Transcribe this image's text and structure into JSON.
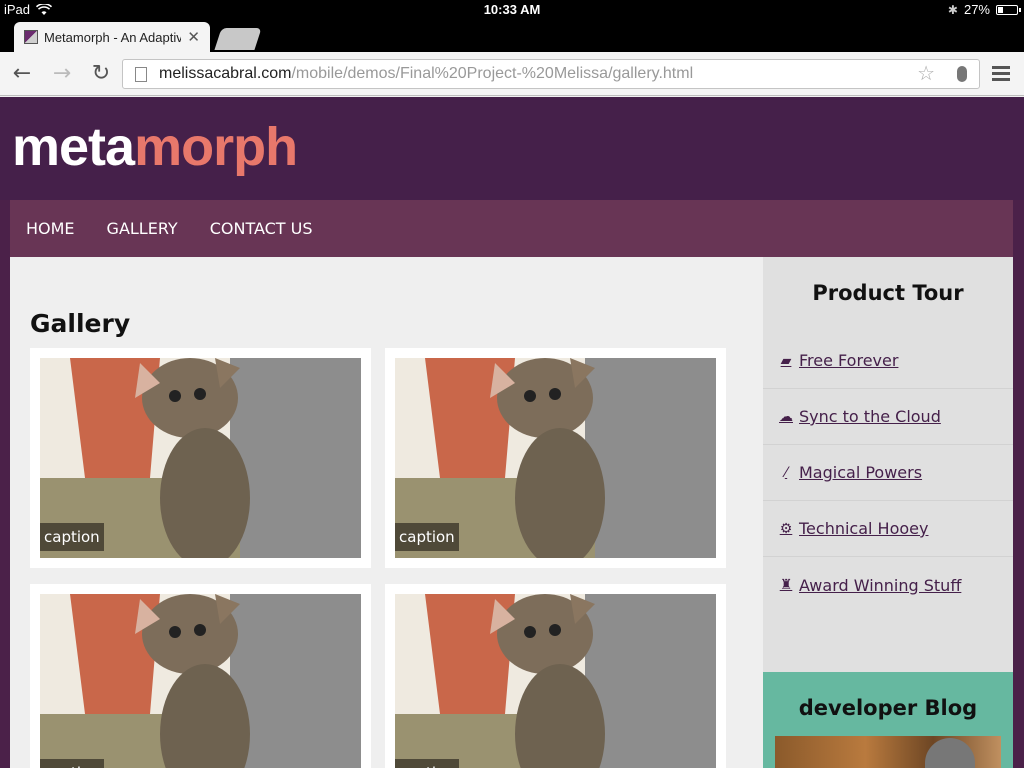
{
  "status": {
    "device": "iPad",
    "time": "10:33 AM",
    "battery": "27%",
    "battery_level": 0.27
  },
  "browser": {
    "tab_title": "Metamorph - An Adaptive",
    "url_domain": "melissacabral.com",
    "url_path": "/mobile/demos/Final%20Project-%20Melissa/gallery.html"
  },
  "site": {
    "logo_part1": "meta",
    "logo_part2": "morph",
    "colors": {
      "header": "#45204a",
      "nav": "#683555",
      "accent": "#e8786b",
      "blog": "#66b8a0"
    },
    "nav": [
      "HOME",
      "GALLERY",
      "CONTACT US"
    ]
  },
  "main": {
    "title": "Gallery",
    "items": [
      {
        "caption": "caption"
      },
      {
        "caption": "caption"
      },
      {
        "caption": "caption"
      },
      {
        "caption": "caption"
      }
    ]
  },
  "sidebar": {
    "title": "Product Tour",
    "items": [
      {
        "label": "Free Forever",
        "icon": "ticket-icon"
      },
      {
        "label": "Sync to the Cloud",
        "icon": "cloud-upload-icon"
      },
      {
        "label": "Magical Powers",
        "icon": "magic-wand-icon"
      },
      {
        "label": "Technical Hooey",
        "icon": "gears-icon"
      },
      {
        "label": "Award Winning Stuff",
        "icon": "trophy-icon"
      }
    ]
  },
  "blog": {
    "title": "developer Blog"
  }
}
